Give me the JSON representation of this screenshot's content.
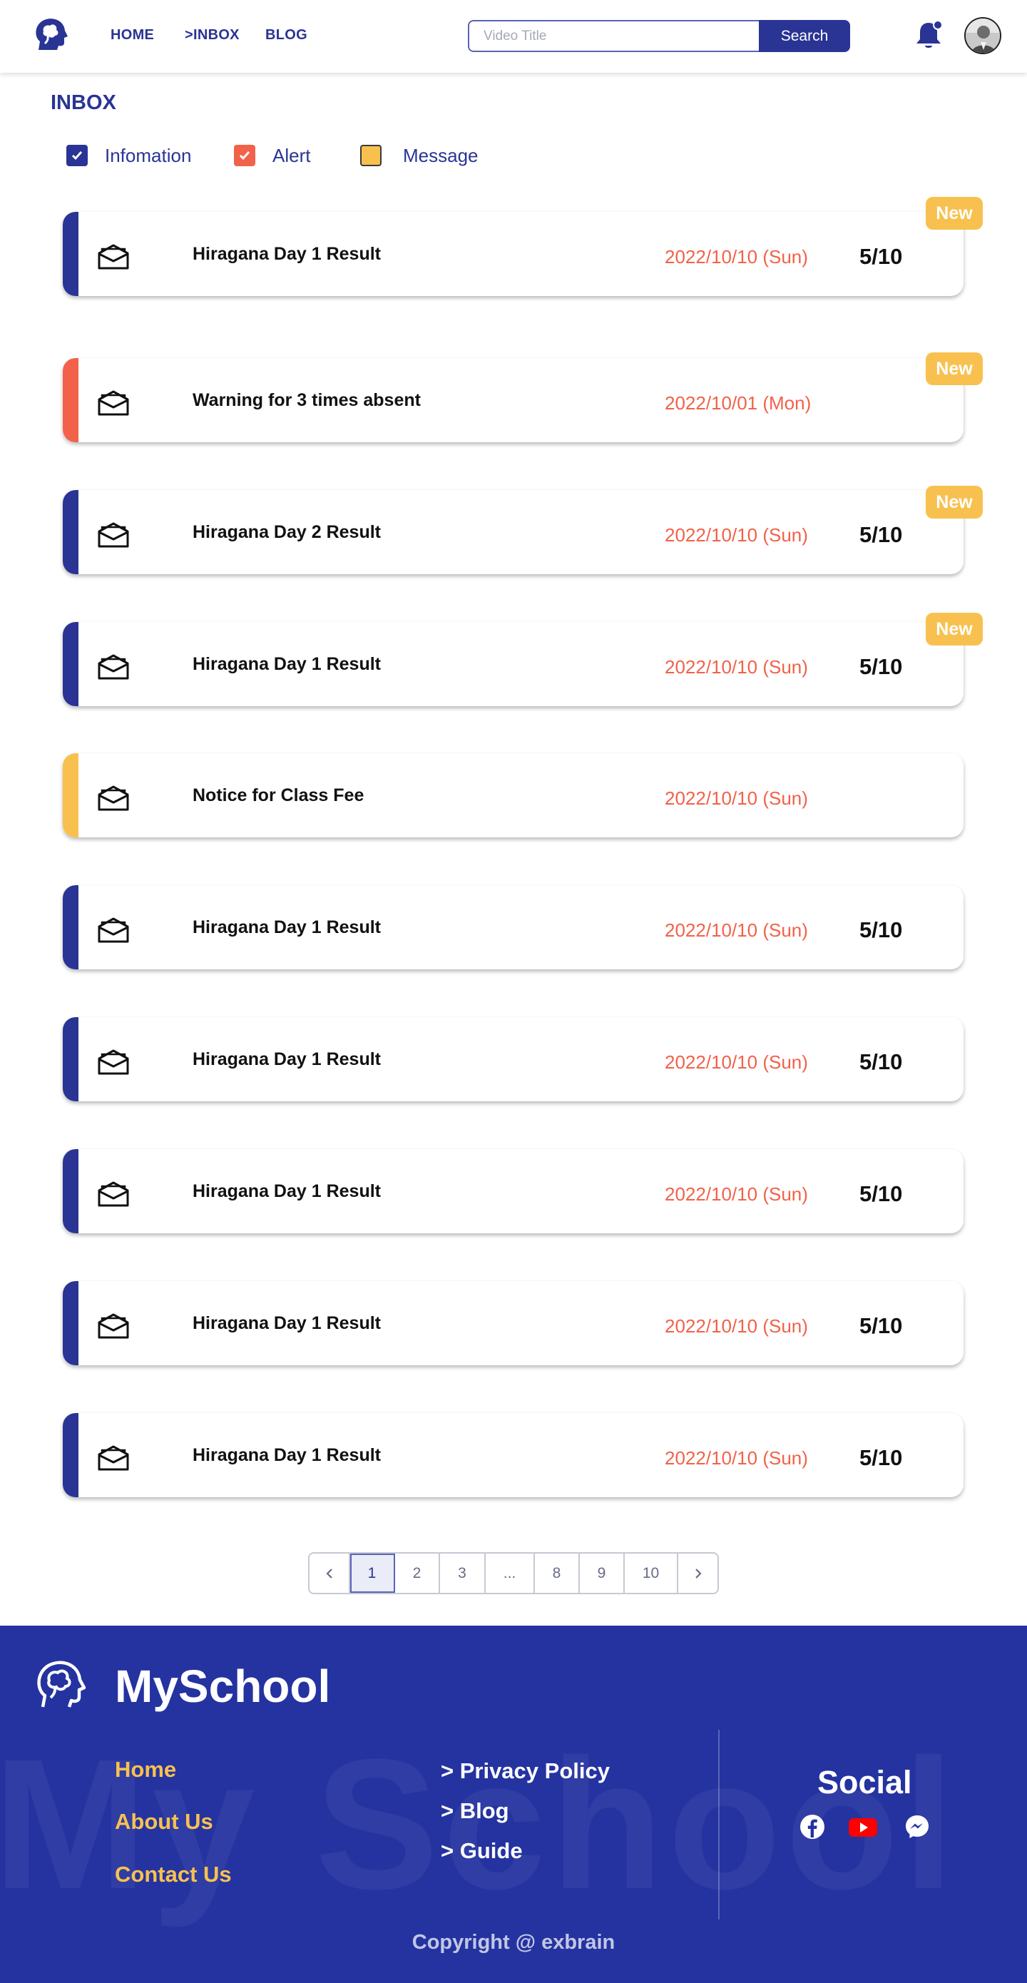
{
  "header": {
    "nav": [
      "HOME",
      ">INBOX",
      "BLOG"
    ],
    "search": {
      "placeholder": "Video Title",
      "button_label": "Search"
    }
  },
  "inbox": {
    "title": "INBOX",
    "filters": [
      {
        "label": "Infomation",
        "checked": true,
        "color": "#2a3494"
      },
      {
        "label": "Alert",
        "checked": true,
        "color": "#f26149"
      },
      {
        "label": "Message",
        "checked": false,
        "color": "#f8c14f"
      }
    ],
    "items": [
      {
        "title": "Hiragana Day 1 Result",
        "date": "2022/10/10 (Sun)",
        "score": "5/10",
        "category": "information",
        "is_new": true,
        "badge": "New"
      },
      {
        "title": "Warning  for 3 times absent",
        "date": "2022/10/01 (Mon)",
        "score": "",
        "category": "alert",
        "is_new": true,
        "badge": "New"
      },
      {
        "title": "Hiragana Day 2 Result",
        "date": "2022/10/10 (Sun)",
        "score": "5/10",
        "category": "information",
        "is_new": true,
        "badge": "New"
      },
      {
        "title": "Hiragana Day 1 Result",
        "date": "2022/10/10 (Sun)",
        "score": "5/10",
        "category": "information",
        "is_new": true,
        "badge": "New"
      },
      {
        "title": "Notice for Class Fee",
        "date": "2022/10/10 (Sun)",
        "score": "",
        "category": "message",
        "is_new": false,
        "badge": ""
      },
      {
        "title": "Hiragana Day 1 Result",
        "date": "2022/10/10 (Sun)",
        "score": "5/10",
        "category": "information",
        "is_new": false,
        "badge": ""
      },
      {
        "title": "Hiragana Day 1 Result",
        "date": "2022/10/10 (Sun)",
        "score": "5/10",
        "category": "information",
        "is_new": false,
        "badge": ""
      },
      {
        "title": "Hiragana Day 1 Result",
        "date": "2022/10/10 (Sun)",
        "score": "5/10",
        "category": "information",
        "is_new": false,
        "badge": ""
      },
      {
        "title": "Hiragana Day 1 Result",
        "date": "2022/10/10 (Sun)",
        "score": "5/10",
        "category": "information",
        "is_new": false,
        "badge": ""
      },
      {
        "title": "Hiragana Day 1 Result",
        "date": "2022/10/10 (Sun)",
        "score": "5/10",
        "category": "information",
        "is_new": false,
        "badge": ""
      }
    ],
    "category_colors": {
      "information": "#2a3494",
      "alert": "#f26149",
      "message": "#f8c14f"
    }
  },
  "pagination": {
    "prev_icon": "chevron-left-icon",
    "next_icon": "chevron-right-icon",
    "pages": [
      "1",
      "2",
      "3",
      "...",
      "8",
      "9",
      "10"
    ],
    "current": "1"
  },
  "footer": {
    "brand": "MySchool",
    "watermark": "My School",
    "links_left": [
      "Home",
      "About Us",
      "Contact Us"
    ],
    "links_right": [
      "> Privacy Policy",
      "> Blog",
      "> Guide"
    ],
    "social_title": "Social",
    "social_icons": [
      "facebook-icon",
      "youtube-icon",
      "messenger-icon"
    ],
    "copyright": "Copyright @ exbrain"
  },
  "colors": {
    "primary": "#2a3494",
    "accent_red": "#f26149",
    "accent_yellow": "#f8c14f",
    "footer_bg": "#2433a0"
  }
}
